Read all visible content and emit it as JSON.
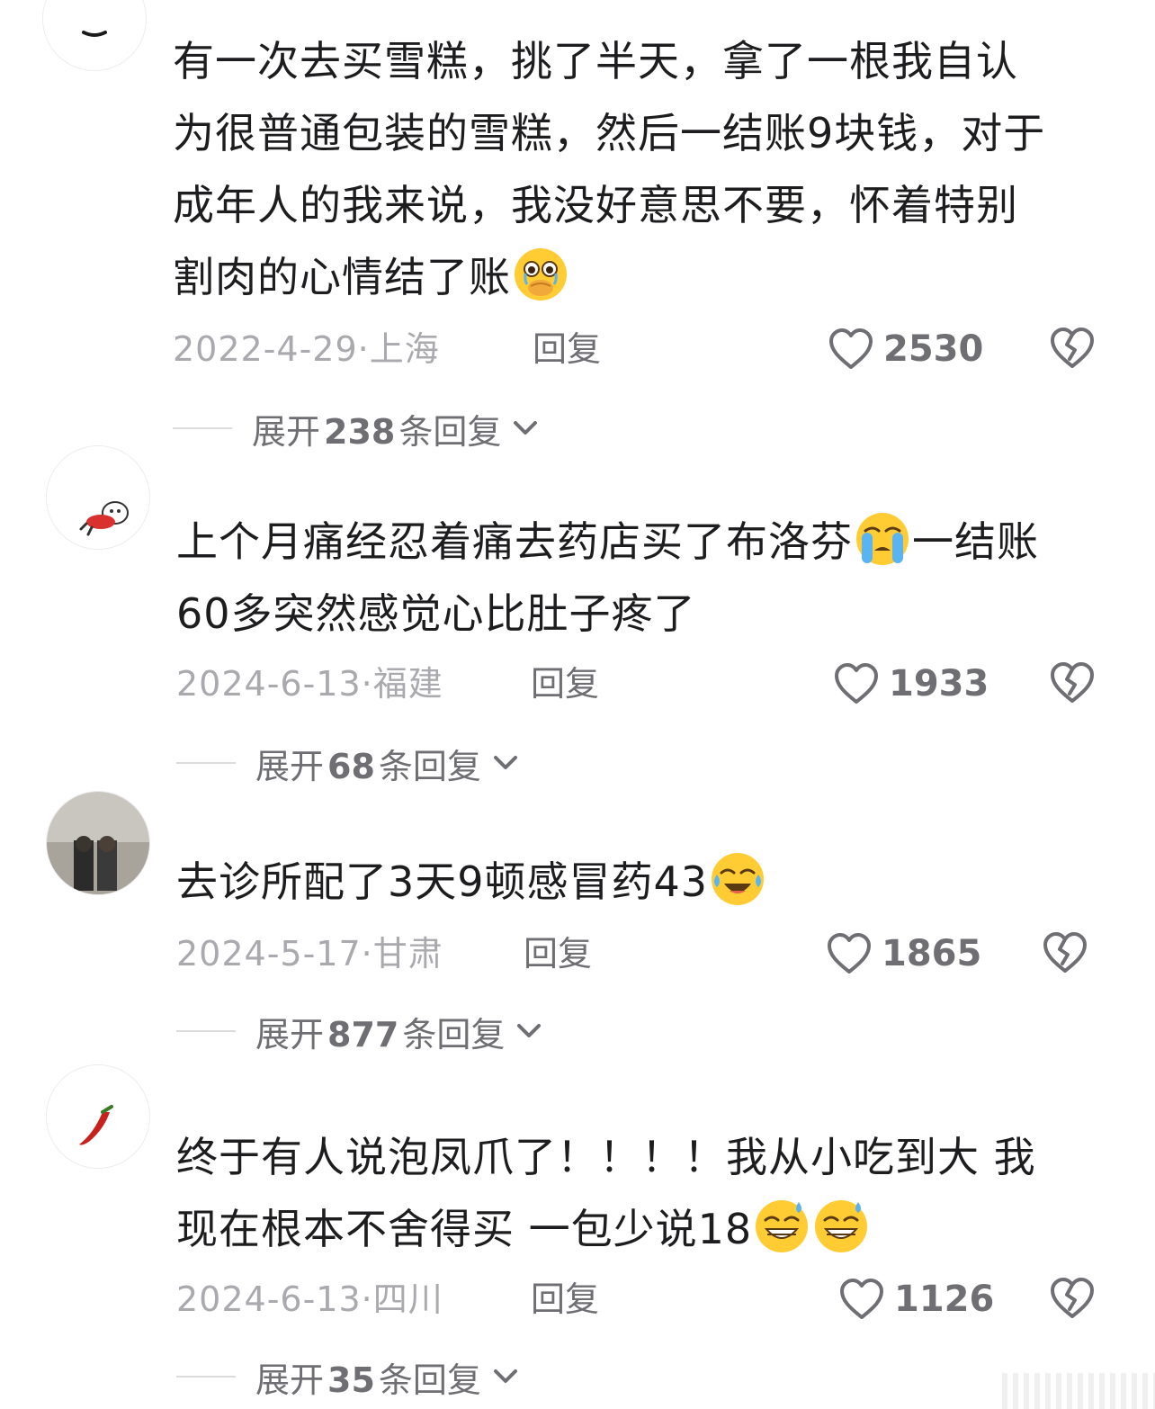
{
  "colors": {
    "text_primary": "#1d1d1f",
    "text_meta": "#a9a9ae",
    "text_secondary": "#6e6e73",
    "divider": "#dcdcdc"
  },
  "comments": [
    {
      "avatar_icon": "smile-avatar-icon",
      "lines": [
        "有一次去买雪糕，挑了半天，拿了一根我自认",
        "为很普通包装的雪糕，然后一结账9块钱，对于",
        "成年人的我来说，我没好意思不要，怀着特别",
        "割肉的心情结了账"
      ],
      "emoji": "holding-back-tears-emoji",
      "date": "2022-4-29",
      "location": "上海",
      "reply_label": "回复",
      "likes": "2530",
      "expand_prefix": "展开",
      "expand_count": "238",
      "expand_suffix": "条回复"
    },
    {
      "avatar_icon": "cartoon-pig-avatar-icon",
      "lines_a": "上个月痛经忍着痛去药店买了布洛芬",
      "emoji": "loudly-crying-emoji",
      "lines_b": "一结账",
      "line2": "60多突然感觉心比肚子疼了",
      "date": "2024-6-13",
      "location": "福建",
      "reply_label": "回复",
      "likes": "1933",
      "expand_prefix": "展开",
      "expand_count": "68",
      "expand_suffix": "条回复"
    },
    {
      "avatar_icon": "person-photo-avatar-icon",
      "line1": "去诊所配了3天9顿感冒药43",
      "emoji": "tears-of-joy-emoji",
      "date": "2024-5-17",
      "location": "甘肃",
      "reply_label": "回复",
      "likes": "1865",
      "expand_prefix": "展开",
      "expand_count": "877",
      "expand_suffix": "条回复"
    },
    {
      "avatar_icon": "chili-pepper-avatar-icon",
      "line1": "终于有人说泡凤爪了！！！！我从小吃到大 我",
      "line2": "现在根本不舍得买 一包少说18",
      "emoji": "grinning-sweat-emoji",
      "date": "2024-6-13",
      "location": "四川",
      "reply_label": "回复",
      "likes": "1126",
      "expand_prefix": "展开",
      "expand_count": "35",
      "expand_suffix": "条回复"
    }
  ]
}
